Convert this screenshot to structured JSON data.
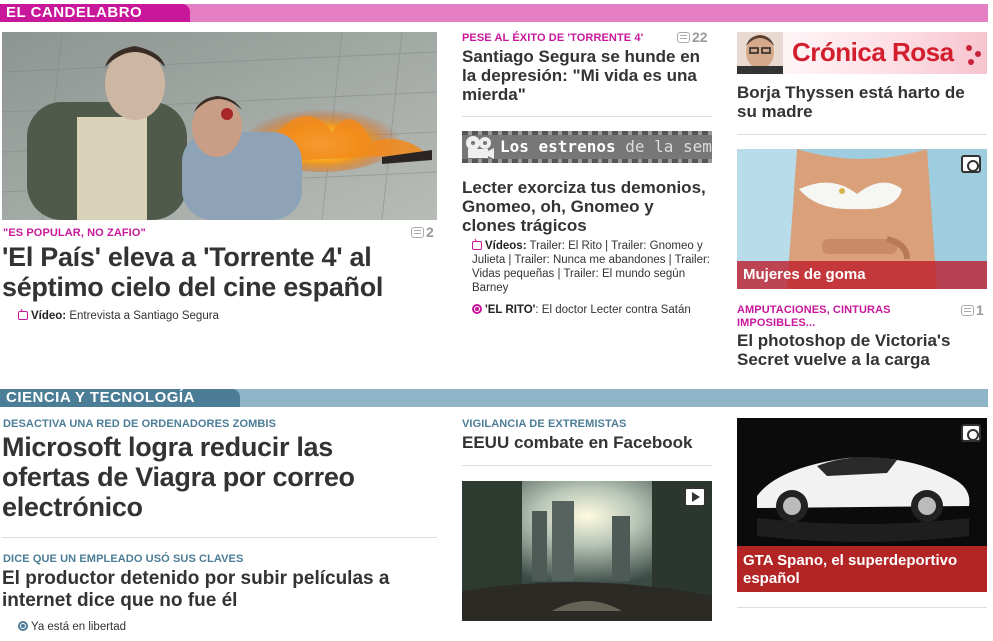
{
  "sections": {
    "candelabro": "EL CANDELABRO",
    "ciencia": "CIENCIA Y TECNOLOGÍA"
  },
  "colors": {
    "pink": "#c8179b",
    "pink_light": "#e67ec4",
    "blue": "#4c7d96",
    "blue_light": "#8fb4c7",
    "red": "#be1e2d"
  },
  "main_story": {
    "kicker": "\"ES POPULAR, NO ZAFIO\"",
    "comments": "2",
    "headline": "'El País' eleva a 'Torrente 4' al séptimo cielo del cine español",
    "video_label": "Vídeo:",
    "video_text": "Entrevista a Santiago Segura"
  },
  "mid_story": {
    "kicker": "PESE AL ÉXITO DE 'TORRENTE 4'",
    "comments": "22",
    "headline": "Santiago Segura se hunde en la depresión: \"Mi vida es una mierda\""
  },
  "estrenos": {
    "banner_bold": "Los estrenos",
    "banner_rest": "de la sem",
    "headline": "Lecter exorciza tus demonios, Gnomeo, oh, Gnomeo y clones trágicos",
    "videos_label": "Vídeos:",
    "videos_text": "Trailer: El Rito | Trailer: Gnomeo y Julieta | Trailer: Nunca me abandones | Trailer: Vidas pequeñas | Trailer: El mundo según Barney",
    "rito_label": "'EL RITO'",
    "rito_text": ": El doctor Lecter contra Satán"
  },
  "cronica": {
    "banner": "Crónica Rosa",
    "headline": "Borja Thyssen está harto de su madre"
  },
  "goma": {
    "caption": "Mujeres de goma",
    "kicker": "AMPUTACIONES, CINTURAS IMPOSIBLES...",
    "comments": "1",
    "headline": "El photoshop de Victoria's Secret vuelve a la carga"
  },
  "microsoft": {
    "kicker": "DESACTIVA UNA RED DE ORDENADORES ZOMBIS",
    "headline": "Microsoft logra reducir las ofertas de Viagra por correo electrónico"
  },
  "productor": {
    "kicker": "DICE QUE UN EMPLEADO USÓ SUS CLAVES",
    "headline": "El productor detenido por subir películas a internet dice que no fue él",
    "link": "Ya está en libertad"
  },
  "eeuu": {
    "kicker": "VIGILANCIA DE EXTREMISTAS",
    "headline": "EEUU combate en Facebook"
  },
  "gta": {
    "caption": "GTA Spano, el superdeportivo español"
  }
}
